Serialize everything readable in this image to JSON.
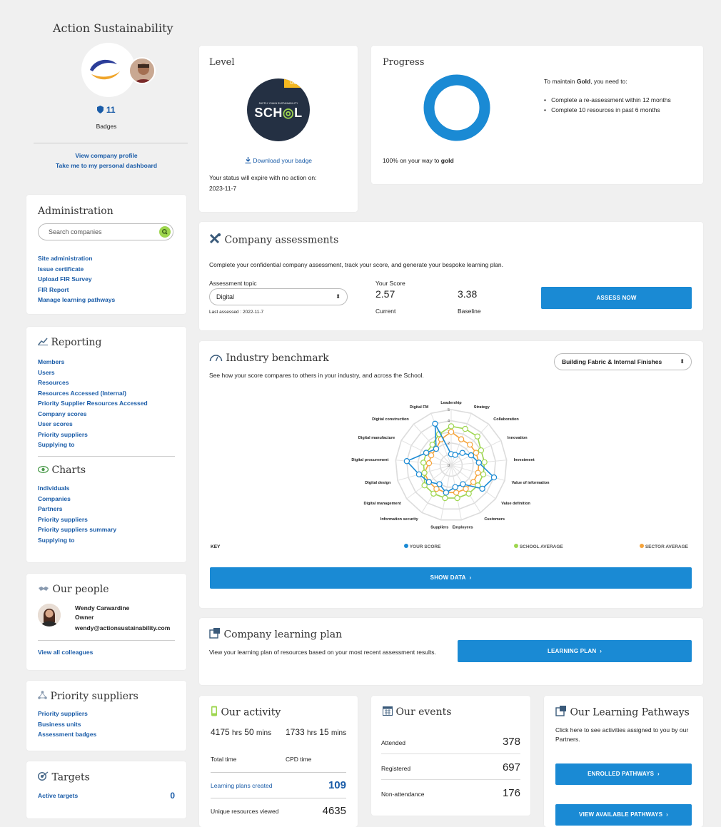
{
  "profile": {
    "company_name": "Action Sustainability",
    "badge_count": "11",
    "badges_label": "Badges",
    "view_company_profile": "View company profile",
    "personal_dashboard": "Take me to my personal dashboard"
  },
  "administration": {
    "title": "Administration",
    "search_placeholder": "Search companies",
    "links": [
      "Site administration",
      "Issue certificate",
      "Upload FIR Survey",
      "FIR Report",
      "Manage learning pathways"
    ]
  },
  "reporting": {
    "title": "Reporting",
    "links": [
      "Members",
      "Users",
      "Resources",
      "Resources Accessed (Internal)",
      "Priority Supplier Resources Accessed",
      "Company scores",
      "User scores",
      "Priority suppliers",
      "Supplying to"
    ]
  },
  "charts": {
    "title": "Charts",
    "links": [
      "Individuals",
      "Companies",
      "Partners",
      "Priority suppliers",
      "Priority suppliers summary",
      "Supplying to"
    ]
  },
  "people": {
    "title": "Our people",
    "name": "Wendy Carwardine",
    "role": "Owner",
    "email": "wendy@actionsustainability.com",
    "view_all": "View all colleagues"
  },
  "priority_suppliers": {
    "title": "Priority suppliers",
    "links": [
      "Priority suppliers",
      "Business units",
      "Assessment badges"
    ]
  },
  "targets": {
    "title": "Targets",
    "active_label": "Active targets",
    "active_value": "0"
  },
  "level": {
    "title": "Level",
    "badge_tag": "GOLD",
    "badge_small": "SUPPLY CHAIN SUSTAINABILITY",
    "badge_word": "SCH",
    "badge_word2": "L",
    "download": "Download your badge",
    "expiry_text": "Your status will expire with no action on:",
    "expiry_date": "2023-11-7"
  },
  "progress": {
    "title": "Progress",
    "percent": 100,
    "caption_prefix": "100% on your way to ",
    "caption_bold": "gold",
    "maintain_prefix": "To maintain ",
    "maintain_bold": "Gold",
    "maintain_suffix": ", you need to:",
    "items": [
      "Complete a re-assessment within 12 months",
      "Complete 10 resources in past 6 months"
    ],
    "ring_color": "#1a8ad4"
  },
  "assessments": {
    "title": "Company assessments",
    "description": "Complete your confidential company assessment, track your score, and generate your bespoke learning plan.",
    "topic_label": "Assessment topic",
    "topic_value": "Digital",
    "last_assessed": "Last assessed : 2022-11-7",
    "score_label": "Your Score",
    "current_value": "2.57",
    "current_label": "Current",
    "baseline_value": "3.38",
    "baseline_label": "Baseline",
    "button": "ASSESS NOW"
  },
  "benchmark": {
    "title": "Industry benchmark",
    "description": "See how your score compares to others in your industry, and across the School.",
    "dropdown": "Building Fabric & Internal Finishes",
    "key_label": "KEY",
    "legend": [
      "YOUR SCORE",
      "SCHOOL AVERAGE",
      "SECTOR AVERAGE"
    ],
    "button": "SHOW DATA"
  },
  "chart_data": {
    "type": "radar",
    "categories": [
      "Leadership",
      "Strategy",
      "Collaboration",
      "Innovation",
      "Investment",
      "Value of information",
      "Value definition",
      "Customers",
      "Employees",
      "Suppliers",
      "Information security",
      "Digital management",
      "Digital design",
      "Digital procurement",
      "Digital manufacture",
      "Digital construction",
      "Digital FM"
    ],
    "ticks": [
      "0",
      "1",
      "2",
      "3",
      "4",
      "5"
    ],
    "rlim": [
      0,
      5
    ],
    "series": [
      {
        "name": "YOUR SCORE",
        "color": "#1a8ad4",
        "values": [
          1,
          1,
          1.5,
          2,
          2.5,
          4,
          3.5,
          2,
          2,
          2.5,
          2,
          2.5,
          3,
          4,
          2.5,
          2,
          4
        ]
      },
      {
        "name": "SCHOOL AVERAGE",
        "color": "#9ed64f",
        "values": [
          3.5,
          3.5,
          3.5,
          3,
          3,
          3,
          3,
          3,
          3,
          3,
          3,
          3,
          2.5,
          2.5,
          2.5,
          2.5,
          3
        ]
      },
      {
        "name": "SECTOR AVERAGE",
        "color": "#f5a33a",
        "values": [
          3,
          2.5,
          2.5,
          2.5,
          2.5,
          2.5,
          2.5,
          2.5,
          2.5,
          2.5,
          2.5,
          2.5,
          2.5,
          2,
          2,
          2,
          2.5
        ]
      }
    ]
  },
  "learning_plan": {
    "title": "Company learning plan",
    "description": "View your learning plan of resources based on your most recent assessment results.",
    "button": "LEARNING PLAN"
  },
  "activity": {
    "title": "Our activity",
    "total_hrs": "4175",
    "total_mins": "50",
    "total_label": "Total time",
    "cpd_hrs": "1733",
    "cpd_mins": "15",
    "cpd_label": "CPD time",
    "hrs_unit": "hrs",
    "mins_unit": "mins",
    "plans_label": "Learning plans created",
    "plans_value": "109",
    "resources_label": "Unique resources viewed",
    "resources_value": "4635"
  },
  "events": {
    "title": "Our events",
    "rows": [
      {
        "label": "Attended",
        "value": "378"
      },
      {
        "label": "Registered",
        "value": "697"
      },
      {
        "label": "Non-attendance",
        "value": "176"
      }
    ]
  },
  "pathways": {
    "title": "Our Learning Pathways",
    "description": "Click here to see activities assigned to you by our Partners.",
    "enrolled_button": "ENROLLED PATHWAYS",
    "available_button": "VIEW AVAILABLE PATHWAYS"
  }
}
